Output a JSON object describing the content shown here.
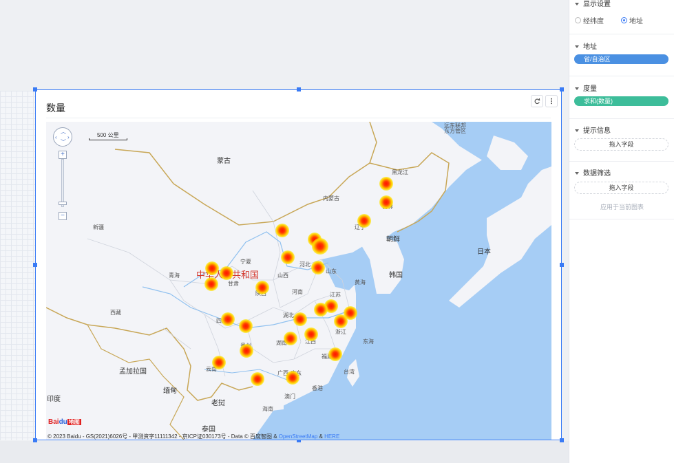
{
  "widget": {
    "title": "数量",
    "refresh_icon": "refresh-icon",
    "more_icon": "more-vertical-icon"
  },
  "map": {
    "scale_label": "500 公里",
    "labels": {
      "mongolia": "蒙古",
      "china": "中华人民共和国",
      "xinjiang": "新疆",
      "xizang": "西藏",
      "qinghai": "青海",
      "gansu": "甘肃",
      "sichuan": "四川",
      "yunnan": "云南",
      "guizhou": "贵州",
      "shaanxi": "陕西",
      "shanxi": "山西",
      "henan": "河南",
      "hubei": "湖北",
      "hunan": "湖南",
      "jiangxi": "江西",
      "guangxi": "广西",
      "guangdong": "广东",
      "fujian": "福建",
      "zhejiang": "浙江",
      "jiangsu": "江苏",
      "shandong": "山东",
      "hebei": "河北",
      "ningxia": "宁夏",
      "neimenggu": "内蒙古",
      "liaoning": "辽宁",
      "jilin": "吉林",
      "heilongjiang": "黑龙江",
      "north_korea": "朝鲜",
      "south_korea": "韩国",
      "japan": "日本",
      "yellow_sea": "黄海",
      "east_sea": "东海",
      "bangladesh": "孟加拉国",
      "myanmar": "缅甸",
      "laos": "老挝",
      "thailand": "泰国",
      "india": "印度",
      "taiwan": "台湾",
      "hainan": "海南",
      "hk": "香港",
      "macau": "澳门",
      "far_east": "远东联邦",
      "far_east2": "东方管区"
    },
    "logo": {
      "bai": "Bai",
      "du": "du",
      "tu": "地图"
    },
    "copyright": "© 2023 Baidu - GS(2021)6026号 - 甲测资字11111342 - 京ICP证030173号 - Data © 百度智图 & ",
    "copyright_link1": "OpenStreetMap",
    "copyright_amp": " & ",
    "copyright_link2": "HERE",
    "hotspot_count": 30
  },
  "panel": {
    "display_settings": {
      "title": "显示设置",
      "options": [
        "经纬度",
        "地址"
      ],
      "selected": "地址"
    },
    "address": {
      "title": "地址",
      "field": "省/自治区",
      "color": "#4a90e2"
    },
    "measure": {
      "title": "度量",
      "field": "求和(数量)",
      "color": "#3dbd9a"
    },
    "tooltip": {
      "title": "提示信息",
      "placeholder": "拖入字段"
    },
    "filter": {
      "title": "数据筛选",
      "placeholder": "拖入字段",
      "hint": "应用于当前图表"
    }
  }
}
